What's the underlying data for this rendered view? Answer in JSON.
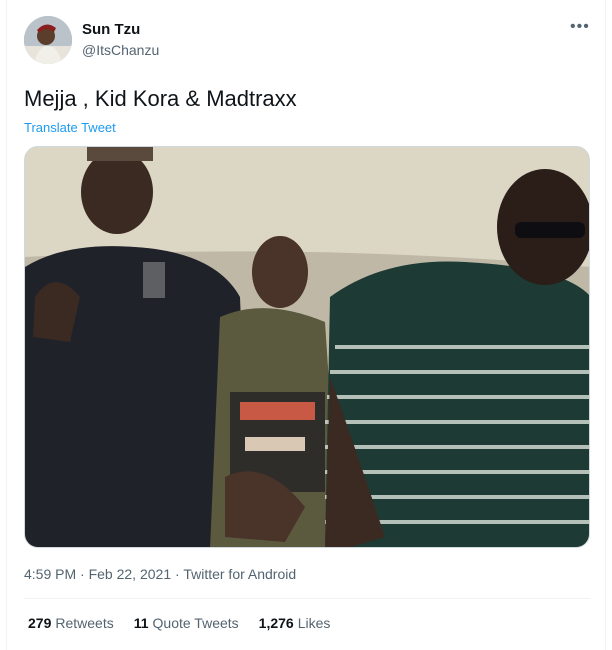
{
  "author": {
    "name": "Sun Tzu",
    "handle": "@ItsChanzu"
  },
  "tweet": {
    "text": "Mejja , Kid Kora & Madtraxx",
    "translate_label": "Translate Tweet",
    "time": "4:59 PM",
    "date": "Feb 22, 2021",
    "source": "Twitter for Android"
  },
  "stats": {
    "retweets_count": "279",
    "retweets_label": "Retweets",
    "quotes_count": "11",
    "quotes_label": "Quote Tweets",
    "likes_count": "1,276",
    "likes_label": "Likes"
  },
  "icons": {
    "more": "more-options-icon"
  },
  "colors": {
    "link": "#1d9bf0",
    "secondary_text": "#536471",
    "primary_text": "#0f1419"
  }
}
